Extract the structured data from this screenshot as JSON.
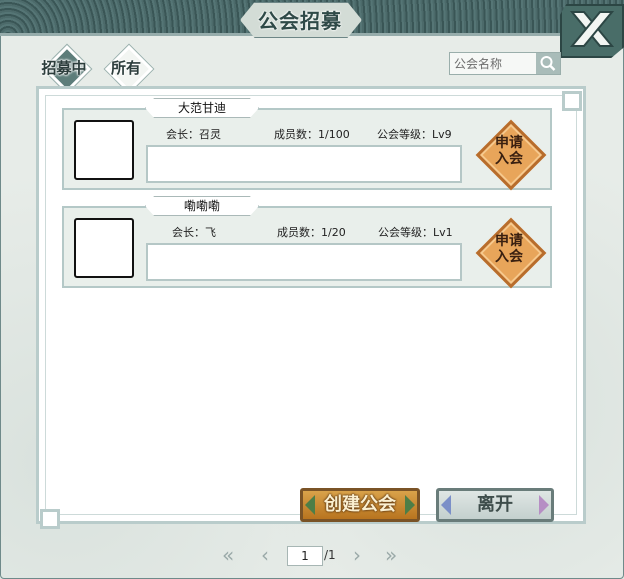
{
  "window": {
    "title": "公会招募"
  },
  "tabs": [
    {
      "label": "招募中",
      "active": true
    },
    {
      "label": "所有",
      "active": false
    }
  ],
  "search": {
    "placeholder": "公会名称"
  },
  "guilds": [
    {
      "name": "大范甘迪",
      "leader": "会长：召灵",
      "members": "成员数：1/100",
      "level": "公会等级：Lv9",
      "apply_label": "申请入会"
    },
    {
      "name": "嘞嘞嘞",
      "leader": "会长：飞",
      "members": "成员数：1/20",
      "level": "公会等级：Lv1",
      "apply_label": "申请入会"
    }
  ],
  "actions": {
    "create": "创建公会",
    "leave": "离开"
  },
  "pagination": {
    "first": "«",
    "prev": "‹",
    "current": "1",
    "total": "/1",
    "next": "›",
    "last": "»"
  },
  "colors": {
    "apply_accent": "#e8a55a",
    "create_accent": "#d9a24a",
    "frame": "#3d5959"
  }
}
